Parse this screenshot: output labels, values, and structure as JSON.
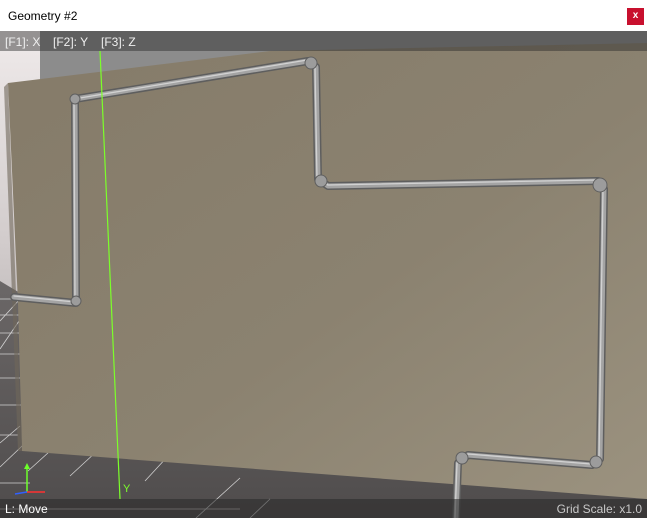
{
  "window": {
    "title": "Geometry #2",
    "close_label": "x"
  },
  "viewport": {
    "hotkeys": [
      {
        "label": "[F1]: X"
      },
      {
        "label": "[F2]: Y"
      },
      {
        "label": "[F3]: Z"
      }
    ],
    "axis_label": "Y",
    "mode_text": "L: Move",
    "grid_scale": "Grid Scale: x1.0"
  },
  "colors": {
    "close_button": "#c8102e",
    "wall": "#8e8573",
    "floor": "#5b5858",
    "pipe": "#a9a9a9",
    "y_axis": "#7cff2a",
    "gizmo_x": "#ff3030",
    "gizmo_z": "#3060ff"
  }
}
